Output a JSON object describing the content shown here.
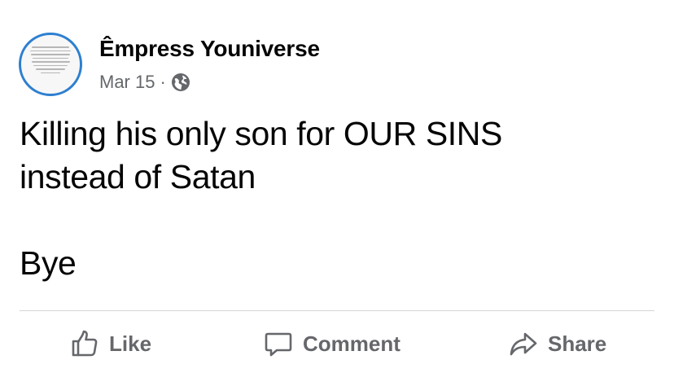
{
  "post": {
    "author": {
      "name": "Êmpress Youniverse",
      "avatar_icon": "text-image-avatar"
    },
    "date": "Mar 15",
    "separator": "·",
    "audience_icon": "globe-icon",
    "body": "Killing his only son for OUR SINS\ninstead of Satan\n\nBye"
  },
  "actions": {
    "like_label": "Like",
    "comment_label": "Comment",
    "share_label": "Share"
  },
  "colors": {
    "avatar_ring": "#2d7fd0",
    "secondary_text": "#65676b",
    "primary_text": "#050505"
  }
}
